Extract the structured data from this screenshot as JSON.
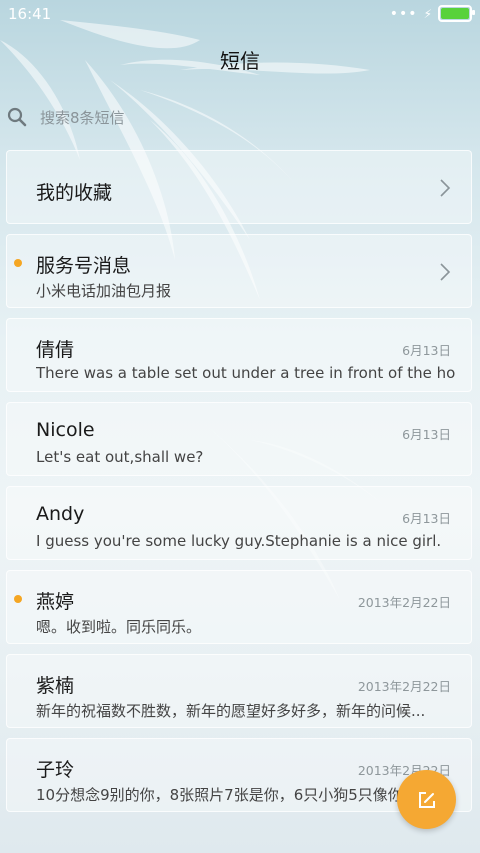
{
  "status_bar": {
    "time": "16:41",
    "signal_dots": "•••",
    "charging_glyph": "⚡",
    "battery_level": 1.0,
    "battery_color": "#58d23a"
  },
  "header": {
    "title": "短信"
  },
  "search": {
    "placeholder": "搜索8条短信"
  },
  "conversations": [
    {
      "name": "我的收藏",
      "preview": "",
      "date": "",
      "unread": false,
      "chevron": true
    },
    {
      "name": "服务号消息",
      "preview": "小米电话加油包月报",
      "date": "",
      "unread": true,
      "chevron": true
    },
    {
      "name": "倩倩",
      "preview": "There was a table set out under a tree in front of the ho...",
      "date": "6月13日",
      "unread": false,
      "chevron": false
    },
    {
      "name": "Nicole",
      "preview": "Let's eat out,shall we?",
      "date": "6月13日",
      "unread": false,
      "chevron": false
    },
    {
      "name": "Andy",
      "preview": "I guess you're some lucky guy.Stephanie is a nice girl.",
      "date": "6月13日",
      "unread": false,
      "chevron": false
    },
    {
      "name": "燕婷",
      "preview": "嗯。收到啦。同乐同乐。",
      "date": "2013年2月22日",
      "unread": true,
      "chevron": false
    },
    {
      "name": "紫楠",
      "preview": "新年的祝福数不胜数，新年的愿望好多好多，新年的问候...",
      "date": "2013年2月22日",
      "unread": false,
      "chevron": false
    },
    {
      "name": "子玲",
      "preview": "10分想念9别的你，8张照片7张是你，6只小狗5只像你",
      "date": "2013年2月22日",
      "unread": false,
      "chevron": false
    }
  ],
  "fab": {
    "icon": "compose-icon",
    "color": "#f5a833"
  },
  "colors": {
    "unread_dot": "#f5a623"
  }
}
